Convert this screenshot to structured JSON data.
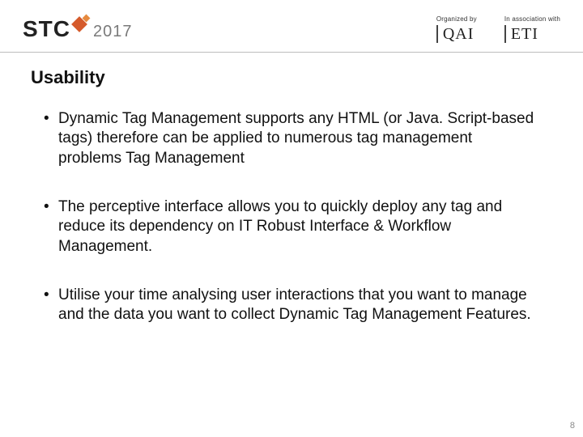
{
  "header": {
    "logo_main": "STC",
    "logo_year": "2017",
    "organized_label": "Organized by",
    "organized_brand": "QAI",
    "association_label": "In association with",
    "association_brand": "ETI"
  },
  "title": "Usability",
  "bullets": [
    "Dynamic Tag Management supports any HTML (or Java. Script-based tags) therefore can be applied to numerous tag management problems Tag Management",
    "The perceptive interface allows you to quickly deploy any tag and reduce its dependency on IT Robust Interface & Workflow Management.",
    "Utilise your time analysing user interactions that you want to manage and the data you want to collect Dynamic Tag Management Features."
  ],
  "page_number": "8"
}
